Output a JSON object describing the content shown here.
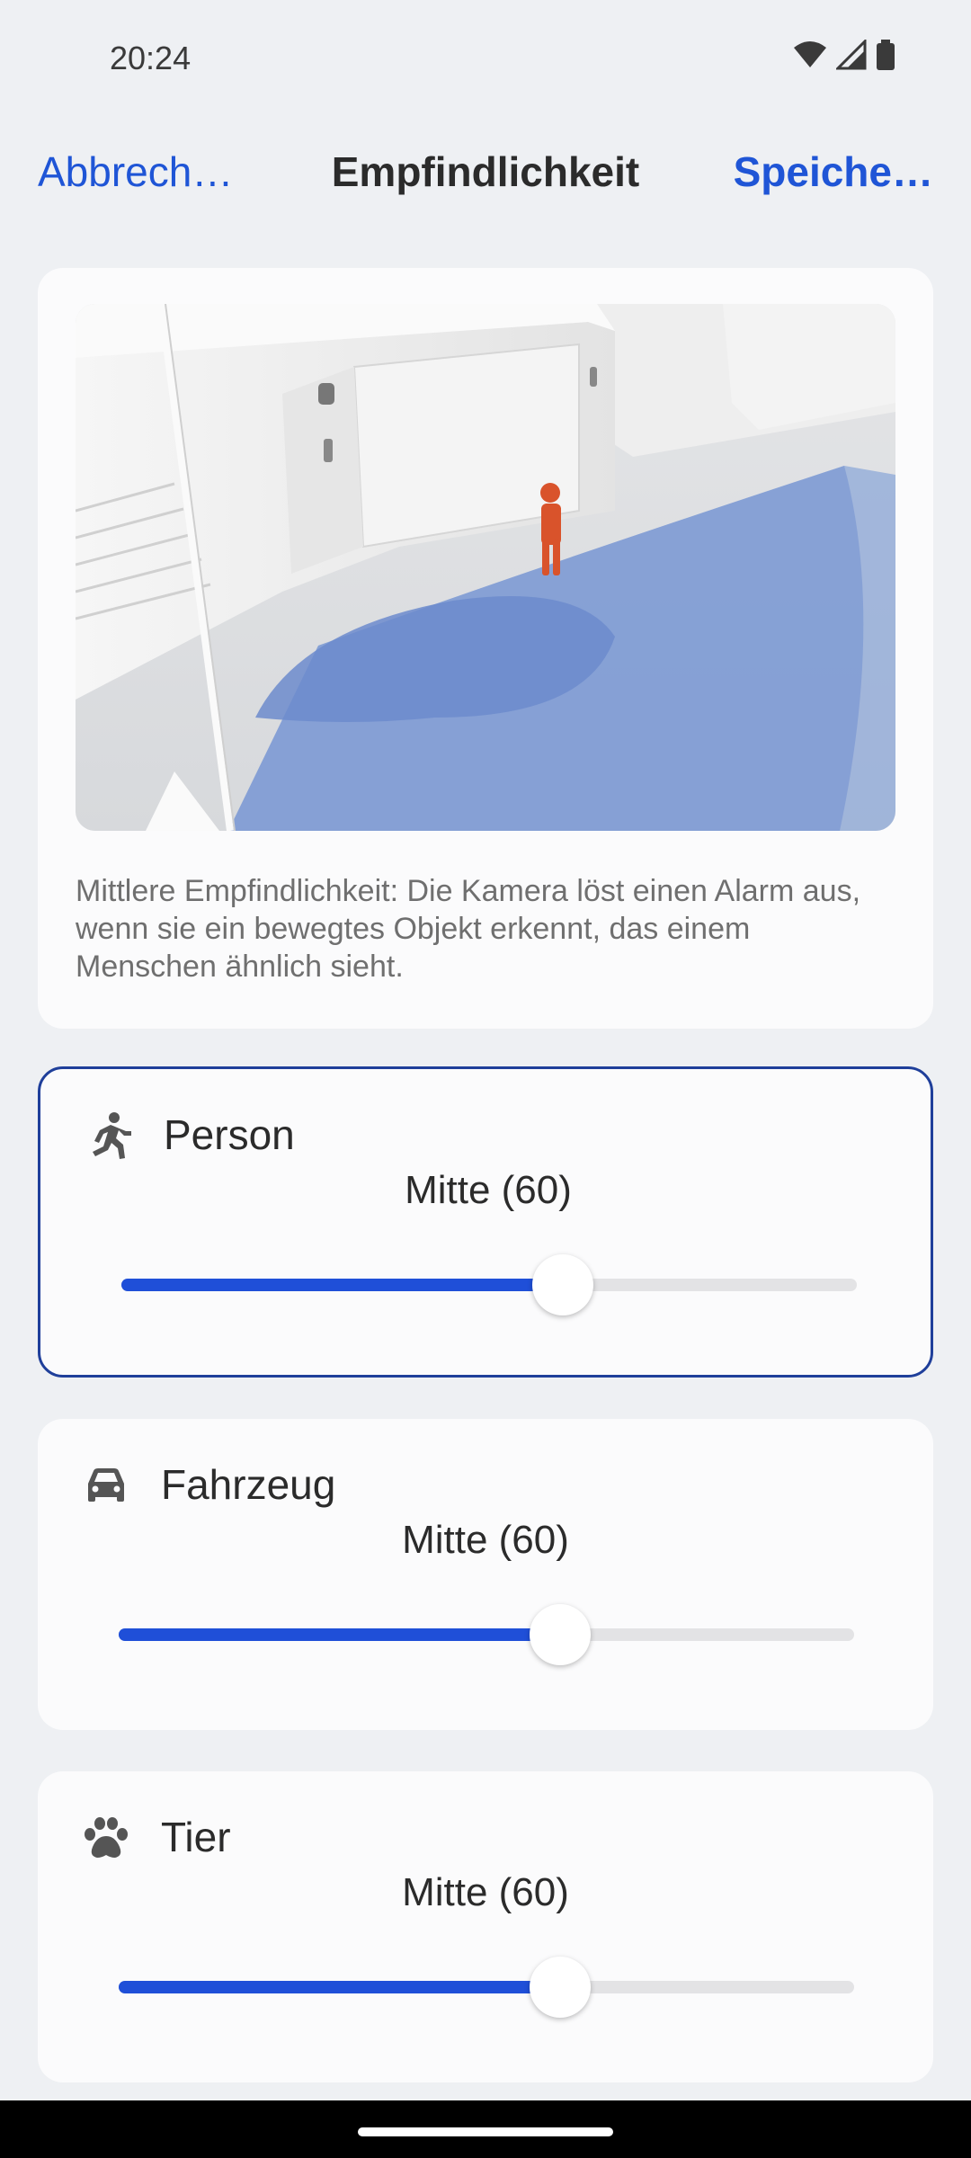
{
  "status_bar": {
    "time": "20:24",
    "icons": [
      "wifi-icon",
      "cellular-signal-icon",
      "battery-icon"
    ]
  },
  "header": {
    "cancel_label": "Abbrech…",
    "title": "Empfindlichkeit",
    "save_label": "Speiche…"
  },
  "preview": {
    "description": "Mittlere Empfindlichkeit: Die Kamera löst einen Alarm aus, wenn sie ein bewegtes Objekt erkennt, das einem Menschen ähnlich sieht."
  },
  "sliders": [
    {
      "label": "Person",
      "value_text": "Mitte (60)",
      "value": 60,
      "max": 100,
      "icon": "running-person-icon",
      "active": true
    },
    {
      "label": "Fahrzeug",
      "value_text": "Mitte (60)",
      "value": 60,
      "max": 100,
      "icon": "car-icon",
      "active": false
    },
    {
      "label": "Tier",
      "value_text": "Mitte (60)",
      "value": 60,
      "max": 100,
      "icon": "paw-icon",
      "active": false
    }
  ],
  "colors": {
    "accent": "#1f4fd8",
    "link": "#1f55d6",
    "active_border": "#1f3f9a",
    "background": "#eef0f3",
    "card": "#fbfbfc"
  }
}
